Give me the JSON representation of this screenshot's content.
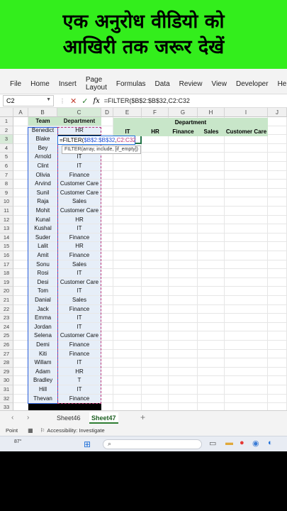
{
  "banner": {
    "line1": "एक अनुरोध वीडियो को",
    "line2": "आखिरी तक जरूर देखें"
  },
  "ribbon_tabs": [
    "File",
    "Home",
    "Insert",
    "Page Layout",
    "Formulas",
    "Data",
    "Review",
    "View",
    "Developer",
    "Help"
  ],
  "formula_bar": {
    "name_box": "C2",
    "formula": "=FILTER($B$2:$B$32,C2:C32"
  },
  "columns": [
    "A",
    "B",
    "C",
    "D",
    "E",
    "F",
    "G",
    "H",
    "I",
    "J"
  ],
  "table": {
    "headers": {
      "team": "Team",
      "department": "Department"
    },
    "rows": [
      {
        "team": "Benedict",
        "dept": "HR"
      },
      {
        "team": "Blake",
        "dept": "=FILTER($B$2:$B$32,C2:C32"
      },
      {
        "team": "Bey",
        "dept": ""
      },
      {
        "team": "Arnold",
        "dept": "IT"
      },
      {
        "team": "Clint",
        "dept": "IT"
      },
      {
        "team": "Olivia",
        "dept": "Finance"
      },
      {
        "team": "Arvind",
        "dept": "Customer Care"
      },
      {
        "team": "Sunil",
        "dept": "Customer Care"
      },
      {
        "team": "Raja",
        "dept": "Sales"
      },
      {
        "team": "Mohit",
        "dept": "Customer Care"
      },
      {
        "team": "Kunal",
        "dept": "HR"
      },
      {
        "team": "Kushal",
        "dept": "IT"
      },
      {
        "team": "Suder",
        "dept": "Finance"
      },
      {
        "team": "Lalit",
        "dept": "HR"
      },
      {
        "team": "Amit",
        "dept": "Finance"
      },
      {
        "team": "Sonu",
        "dept": "Sales"
      },
      {
        "team": "Rosi",
        "dept": "IT"
      },
      {
        "team": "Desi",
        "dept": "Customer Care"
      },
      {
        "team": "Tom",
        "dept": "IT"
      },
      {
        "team": "Danial",
        "dept": "Sales"
      },
      {
        "team": "Jack",
        "dept": "Finance"
      },
      {
        "team": "Emma",
        "dept": "IT"
      },
      {
        "team": "Jordan",
        "dept": "IT"
      },
      {
        "team": "Selena",
        "dept": "Customer Care"
      },
      {
        "team": "Demi",
        "dept": "Finance"
      },
      {
        "team": "Kiti",
        "dept": "Finance"
      },
      {
        "team": "Willam",
        "dept": "IT"
      },
      {
        "team": "Adam",
        "dept": "HR"
      },
      {
        "team": "Bradley",
        "dept": "T"
      },
      {
        "team": "Hill",
        "dept": "IT"
      },
      {
        "team": "Thevan",
        "dept": "Finance"
      }
    ]
  },
  "editing": {
    "prefix": "=FILTER(",
    "range1": "$B$2:$B$32",
    "sep": ",",
    "range2": "C2:C32"
  },
  "tooltip": "FILTER(array, include, [if_empty])",
  "dept_table": {
    "title": "Department",
    "cols": [
      "IT",
      "HR",
      "Finance",
      "Sales",
      "Customer Care"
    ]
  },
  "sheets": [
    "Sheet46",
    "Sheet47"
  ],
  "status": {
    "mode": "Point",
    "accessibility": "Accessibility: Investigate"
  },
  "taskbar": {
    "temp": "87°"
  },
  "colors": {
    "banner": "#33ee1c",
    "header_green": "#c8e6c9",
    "select_blue": "#2b5fd9",
    "range_magenta": "#b8337a"
  }
}
